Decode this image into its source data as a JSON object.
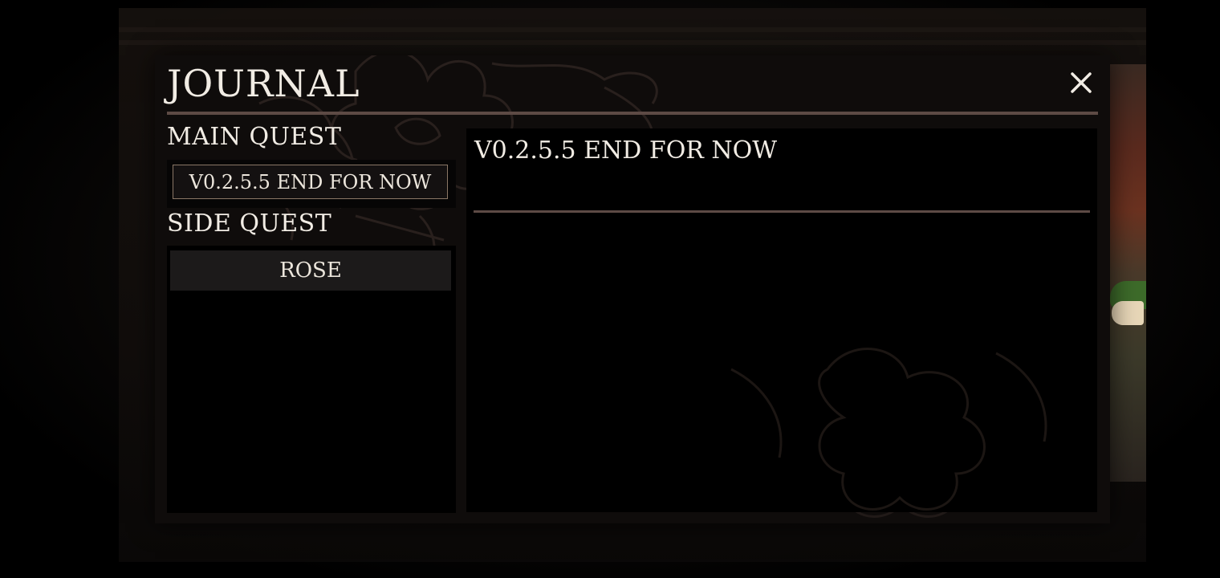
{
  "journal": {
    "title": "JOURNAL",
    "close_icon": "close-icon"
  },
  "main_quest": {
    "heading": "MAIN QUEST",
    "items": [
      {
        "label": "V0.2.5.5 END FOR NOW",
        "selected": true
      }
    ]
  },
  "side_quest": {
    "heading": "SIDE QUEST",
    "items": [
      {
        "label": "ROSE",
        "selected": false
      }
    ]
  },
  "detail": {
    "title": "V0.2.5.5 END FOR NOW",
    "description": ""
  },
  "colors": {
    "panel": "#0f0c0b",
    "rule": "#5d4a45",
    "text": "#f1ece4",
    "selected_border": "#8a7766"
  }
}
